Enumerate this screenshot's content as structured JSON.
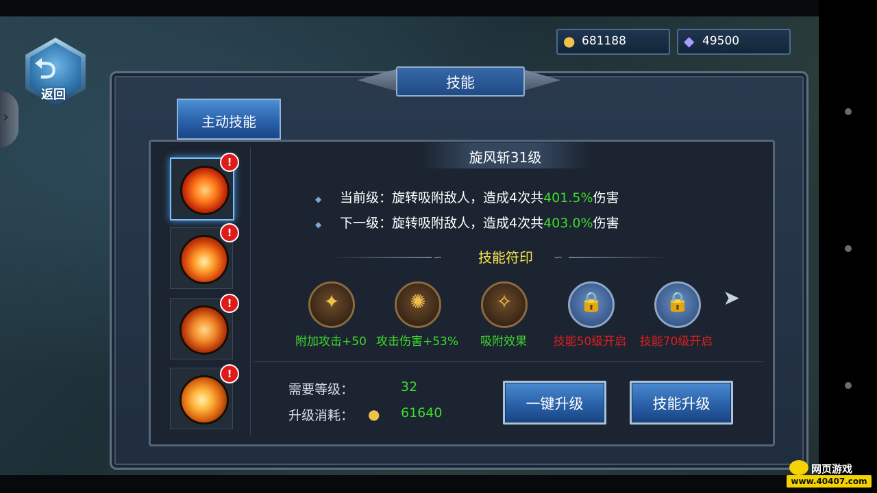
{
  "nav": {
    "back_label": "返回"
  },
  "currency": {
    "gold": "681188",
    "gems": "49500"
  },
  "window": {
    "title": "技能"
  },
  "tabs": [
    {
      "label": "主动技能",
      "active": true
    }
  ],
  "skill": {
    "name": "旋风斩31级",
    "current_prefix": "当前级：旋转吸附敌人，造成4次共",
    "current_value": "401.5%",
    "current_suffix": "伤害",
    "next_prefix": "下一级：旋转吸附敌人，造成4次共",
    "next_value": "403.0%",
    "next_suffix": "伤害"
  },
  "skill_list": [
    {
      "icon": "whirlwind-icon",
      "selected": true,
      "badge": "!"
    },
    {
      "icon": "fire-slash-icon",
      "selected": false,
      "badge": "!"
    },
    {
      "icon": "fire-shield-icon",
      "selected": false,
      "badge": "!"
    },
    {
      "icon": "flame-dash-icon",
      "selected": false,
      "badge": "!"
    }
  ],
  "runes": {
    "title": "技能符印",
    "items": [
      {
        "label": "附加攻击+50",
        "icon": "rune-attack-icon",
        "locked": false
      },
      {
        "label": "攻击伤害+53%",
        "icon": "rune-vortex-icon",
        "locked": false
      },
      {
        "label": "吸附效果",
        "icon": "rune-absorb-icon",
        "locked": false
      },
      {
        "label": "技能50级开启",
        "icon": "lock-icon",
        "locked": true
      },
      {
        "label": "技能70级开启",
        "icon": "lock-icon",
        "locked": true
      }
    ]
  },
  "requirements": {
    "level_label": "需要等级：",
    "level_value": "32",
    "cost_label": "升级消耗：",
    "cost_value": "61640"
  },
  "buttons": {
    "one_click": "一键升级",
    "upgrade": "技能升级"
  },
  "watermark": {
    "top": "网页游戏",
    "bottom": "www.40407.com"
  },
  "colors": {
    "accent_blue": "#2a62ab",
    "value_green": "#3fdb2d",
    "locked_red": "#e21e1e",
    "title_yellow": "#f4e34c"
  }
}
